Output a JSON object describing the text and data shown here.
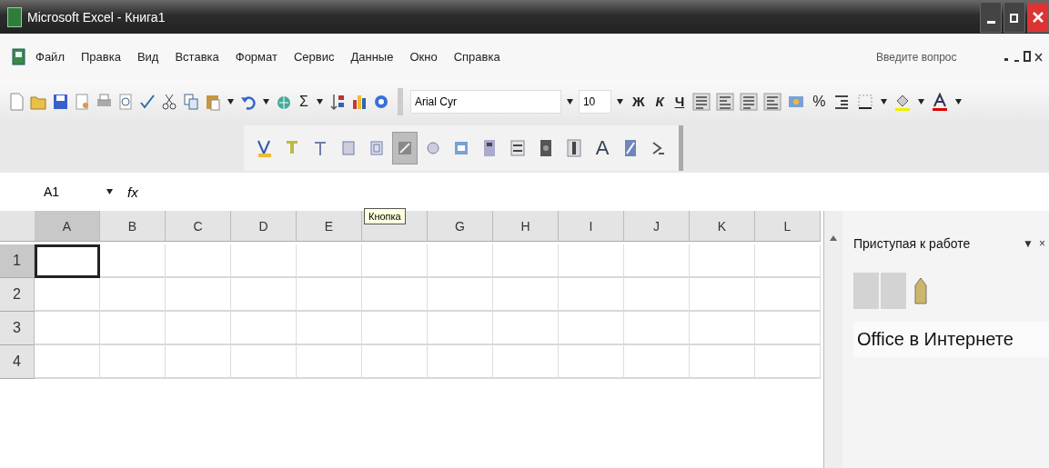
{
  "window": {
    "title": "Microsoft Excel - Книга1"
  },
  "menu": [
    {
      "label": "Файл"
    },
    {
      "label": "Правка"
    },
    {
      "label": "Вид"
    },
    {
      "label": "Вставка"
    },
    {
      "label": "Формат"
    },
    {
      "label": "Сервис"
    },
    {
      "label": "Данные"
    },
    {
      "label": "Окно"
    },
    {
      "label": "Справка"
    }
  ],
  "question_box": {
    "placeholder": "Введите вопрос"
  },
  "toolbar": {
    "sum": "Σ",
    "font": "Arial Cyr",
    "size": "10",
    "format_buttons": [
      {
        "label": "Ж"
      },
      {
        "label": "К"
      },
      {
        "label": "Ч"
      }
    ],
    "percent": "%"
  },
  "forms_toolbar": {
    "buttons": [
      {
        "selected": false
      },
      {
        "selected": false
      },
      {
        "selected": false
      },
      {
        "selected": false
      },
      {
        "selected": false
      },
      {
        "selected": true
      },
      {
        "selected": false
      },
      {
        "selected": false
      },
      {
        "selected": false
      },
      {
        "selected": false
      },
      {
        "selected": false
      },
      {
        "selected": false
      },
      {
        "selected": false,
        "text": "A"
      },
      {
        "selected": false
      },
      {
        "selected": false
      }
    ]
  },
  "tooltip": "Кнопка",
  "formula_bar": {
    "name_box": "A1",
    "fx": "fx"
  },
  "columns": [
    {
      "label": "A",
      "selected": true
    },
    {
      "label": "B",
      "selected": false
    },
    {
      "label": "C",
      "selected": false
    },
    {
      "label": "D",
      "selected": false
    },
    {
      "label": "E",
      "selected": false
    },
    {
      "selected": false
    },
    {
      "label": "G",
      "selected": false
    },
    {
      "label": "H",
      "selected": false
    },
    {
      "label": "I",
      "selected": false
    },
    {
      "label": "J",
      "selected": false
    },
    {
      "label": "K",
      "selected": false
    },
    {
      "label": "L",
      "selected": false
    }
  ],
  "rows": [
    {
      "label": "1",
      "selected": true
    },
    {
      "label": "2",
      "selected": false
    },
    {
      "label": "3",
      "selected": false
    },
    {
      "label": "4",
      "selected": false
    }
  ],
  "task_pane": {
    "title": "Приступая к работе",
    "dropdown": "▼",
    "close": "×",
    "section": "Office в Интернете"
  }
}
